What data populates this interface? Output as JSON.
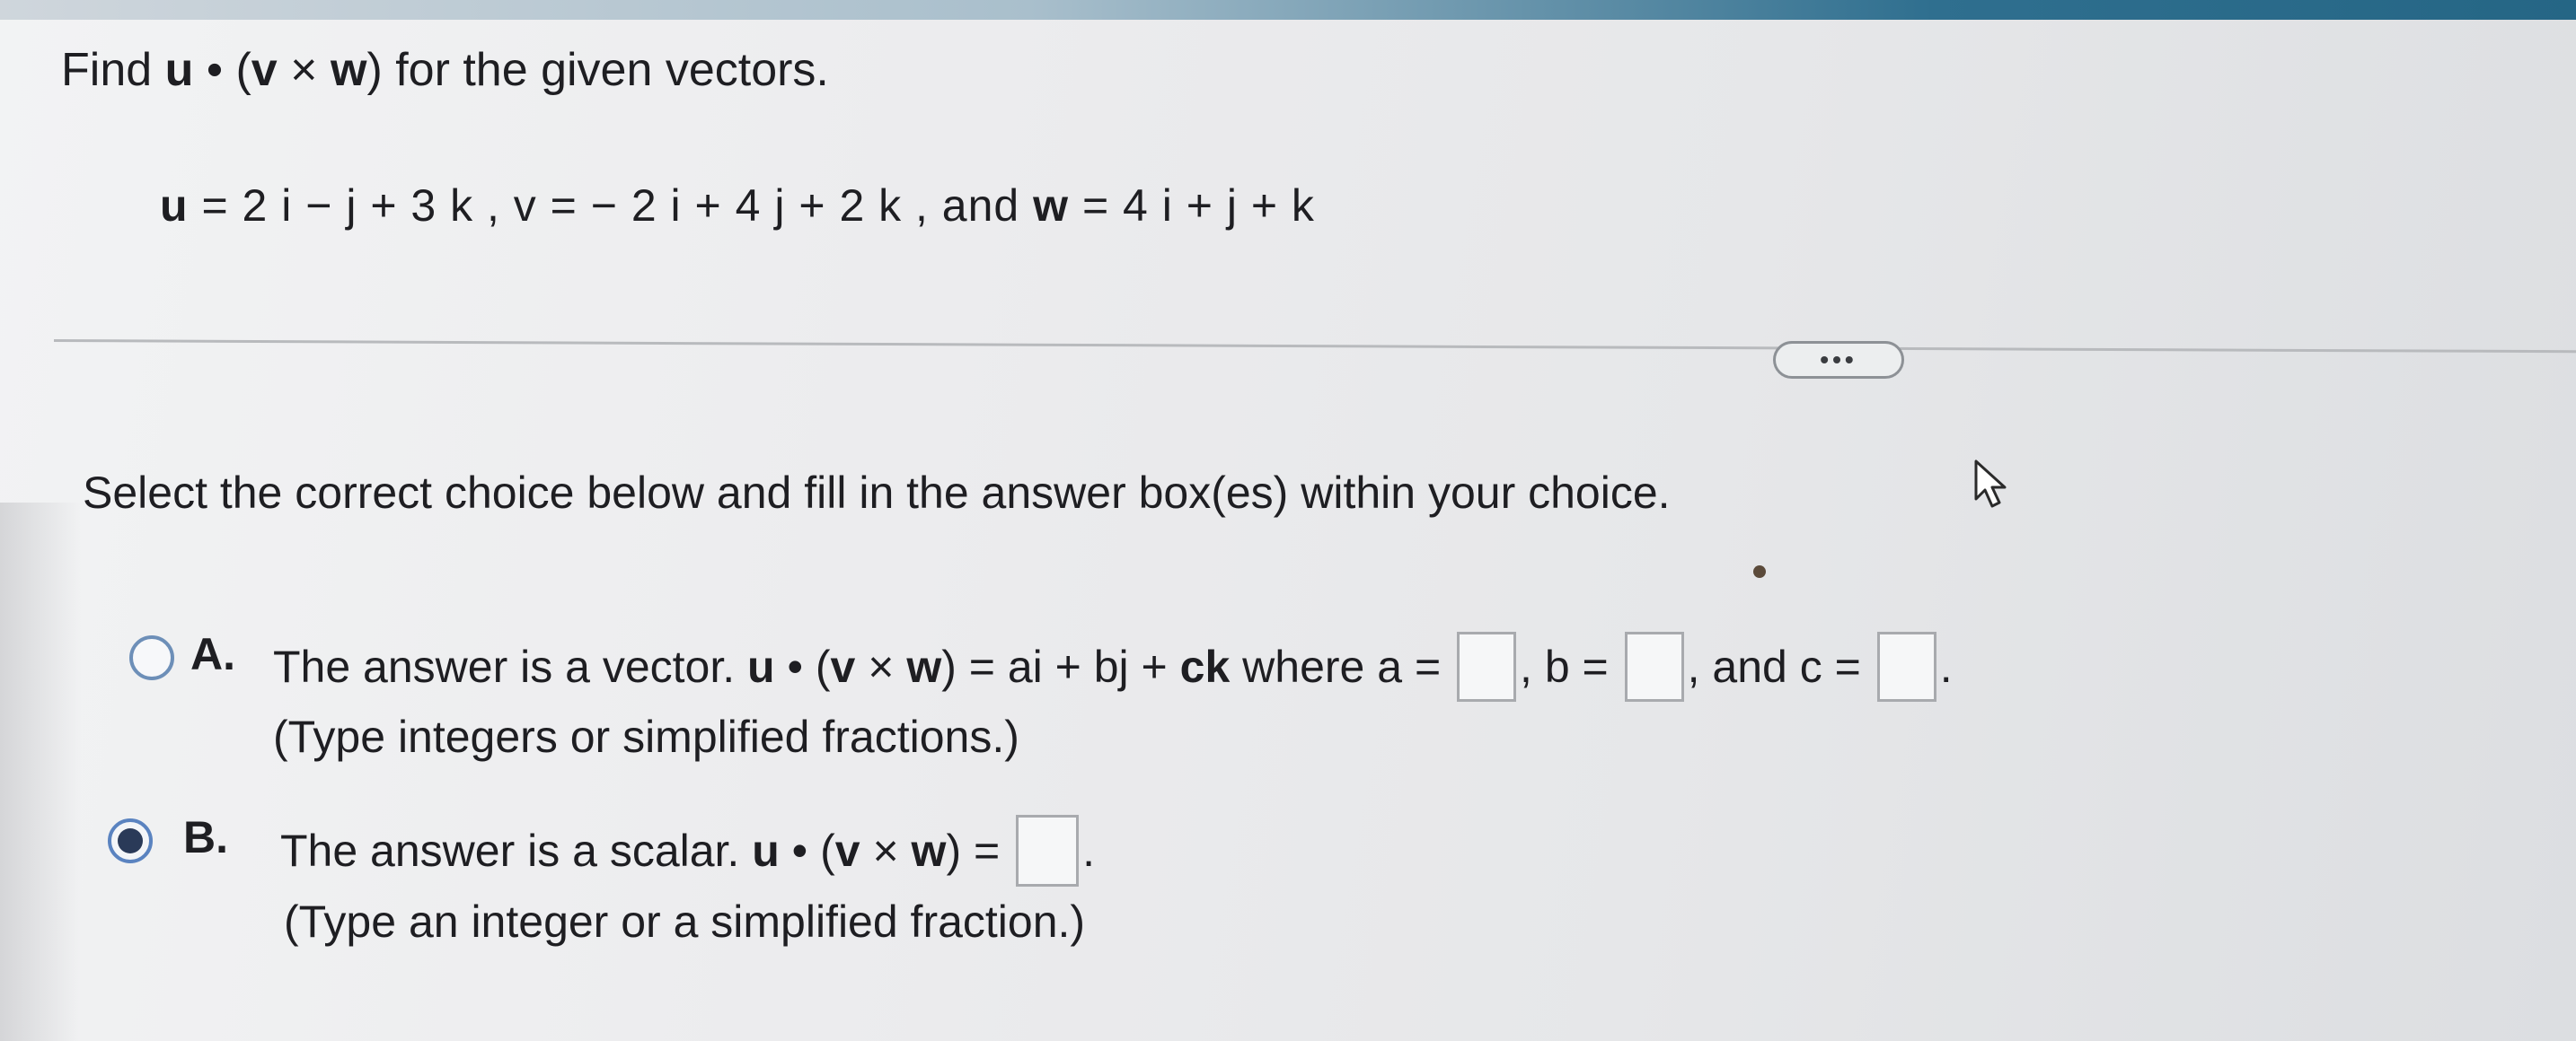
{
  "question": {
    "title_prefix": "Find ",
    "title_expr_u": "u",
    "title_dot": " • (",
    "title_expr_v": "v",
    "title_cross": " × ",
    "title_expr_w": "w",
    "title_suffix": ") for the given vectors.",
    "vectors": {
      "u_label": "u",
      "u_expr": " = 2 i  −  j  + 3 k , v = − 2 i  + 4 j  + 2 k , and ",
      "w_label": "w",
      "w_expr": " = 4 i  +  j  +  k"
    }
  },
  "more_button": {
    "label": "•••"
  },
  "instructions": "Select the correct choice below and fill in the answer box(es) within your choice.",
  "choices": [
    {
      "letter": "A.",
      "selected": false,
      "text_before": "The answer is a vector. ",
      "expr_u": "u",
      "expr_mid": " • (",
      "expr_v": "v",
      "expr_cross": " × ",
      "expr_w": "w",
      "expr_after": ") = ai + bj + ",
      "expr_ck": "ck",
      "text_where": " where a = ",
      "text_b": ", b = ",
      "text_c": ", and c = ",
      "text_end": ".",
      "hint": "(Type integers or simplified fractions.)",
      "answers": {
        "a": "",
        "b": "",
        "c": ""
      }
    },
    {
      "letter": "B.",
      "selected": true,
      "text_before": "The answer is a scalar. ",
      "expr_u": "u",
      "expr_mid": " • (",
      "expr_v": "v",
      "expr_cross": " × ",
      "expr_w": "w",
      "expr_after": ") = ",
      "text_end": ".",
      "hint": "(Type an integer or a simplified fraction.)",
      "answers": {
        "value": ""
      }
    }
  ],
  "icons": {
    "cursor": "pointer-cursor-icon"
  },
  "colors": {
    "radio_border": "#6d8fb8",
    "radio_selected_fill": "#2a3a58",
    "top_bar_accent": "#256685"
  }
}
